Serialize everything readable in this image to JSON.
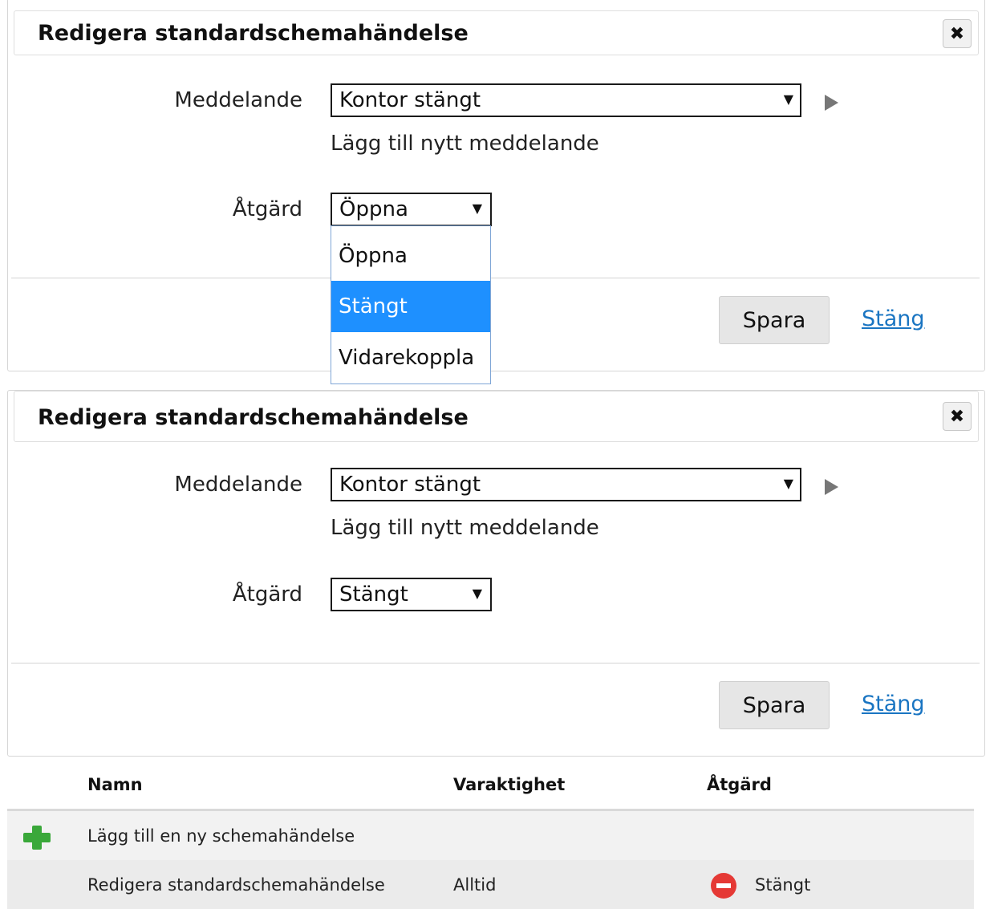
{
  "dialog1": {
    "title": "Redigera standardschemahändelse",
    "close_glyph": "✖",
    "message_label": "Meddelande",
    "message_value": "Kontor stängt",
    "add_message": "Lägg till nytt meddelande",
    "action_label": "Åtgärd",
    "action_value": "Öppna",
    "action_options": [
      "Öppna",
      "Stängt",
      "Vidarekoppla"
    ],
    "highlighted_option": "Stängt",
    "save_label": "Spara",
    "close_link": "Stäng"
  },
  "dialog2": {
    "title": "Redigera standardschemahändelse",
    "close_glyph": "✖",
    "message_label": "Meddelande",
    "message_value": "Kontor stängt",
    "add_message": "Lägg till nytt meddelande",
    "action_label": "Åtgärd",
    "action_value": "Stängt",
    "save_label": "Spara",
    "close_link": "Stäng"
  },
  "table": {
    "headers": [
      "Namn",
      "Varaktighet",
      "Åtgärd"
    ],
    "add_row": "Lägg till en ny schemahändelse",
    "rows": [
      {
        "name": "Redigera standardschemahändelse",
        "duration": "Alltid",
        "action": "Stängt"
      }
    ]
  },
  "icons": {
    "add": "plus-icon",
    "status": "stop-icon",
    "dropdown": "triangle-down-icon",
    "play": "play-arrow-icon",
    "close": "close-icon"
  },
  "colors": {
    "link": "#1a75c2",
    "highlight": "#1e90ff",
    "add_icon": "#3aa83a",
    "stop_icon": "#e53935"
  }
}
